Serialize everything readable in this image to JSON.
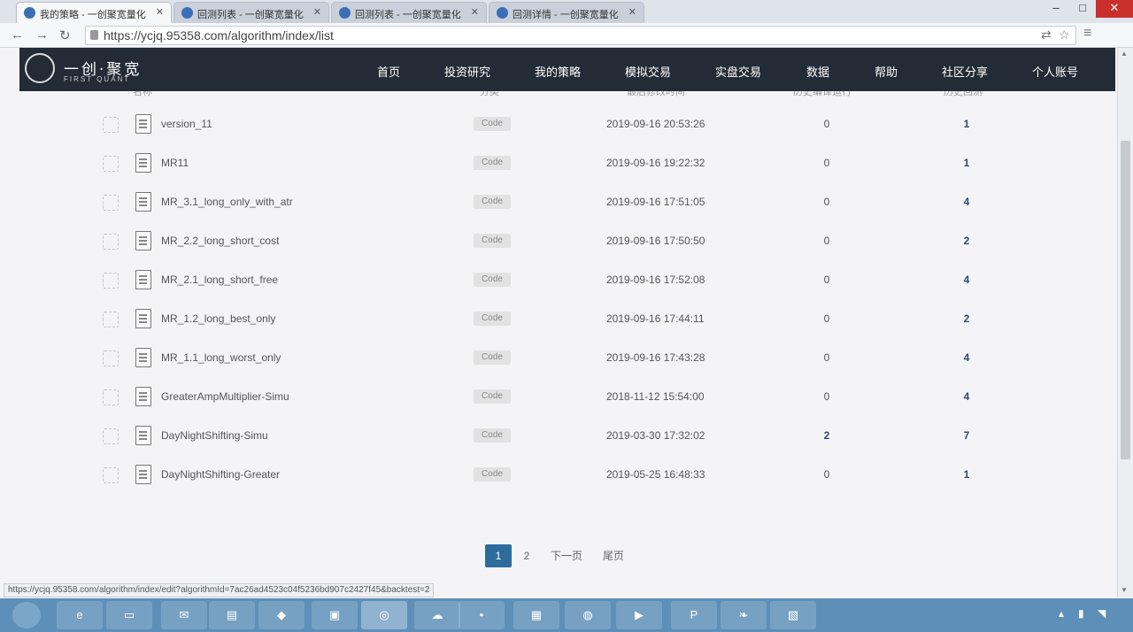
{
  "browser": {
    "tabs": [
      {
        "title": "我的策略 - 一创聚宽量化"
      },
      {
        "title": "回测列表 - 一创聚宽量化"
      },
      {
        "title": "回测列表 - 一创聚宽量化"
      },
      {
        "title": "回测详情 - 一创聚宽量化"
      }
    ],
    "url": "https://ycjq.95358.com/algorithm/index/list",
    "status_url": "https://ycjq.95358.com/algorithm/index/edit?algorithmId=7ac26ad4523c04f5236bd907c2427f45&backtest=2"
  },
  "site": {
    "logo_text": "一创·聚宽",
    "logo_sub": "FIRST QUANT",
    "nav": [
      "首页",
      "投资研究",
      "我的策略",
      "模拟交易",
      "实盘交易",
      "数据",
      "帮助",
      "社区分享",
      "个人账号"
    ]
  },
  "table": {
    "headers": [
      "名称",
      "分类",
      "最后修改时间",
      "历史编译运行",
      "历史回测"
    ],
    "rows": [
      {
        "name": "version_11",
        "tag": "Code",
        "time": "2019-09-16 20:53:26",
        "runs": "0",
        "backtests": "1"
      },
      {
        "name": "MR11",
        "tag": "Code",
        "time": "2019-09-16 19:22:32",
        "runs": "0",
        "backtests": "1"
      },
      {
        "name": "MR_3.1_long_only_with_atr",
        "tag": "Code",
        "time": "2019-09-16 17:51:05",
        "runs": "0",
        "backtests": "4"
      },
      {
        "name": "MR_2.2_long_short_cost",
        "tag": "Code",
        "time": "2019-09-16 17:50:50",
        "runs": "0",
        "backtests": "2"
      },
      {
        "name": "MR_2.1_long_short_free",
        "tag": "Code",
        "time": "2019-09-16 17:52:08",
        "runs": "0",
        "backtests": "4"
      },
      {
        "name": "MR_1.2_long_best_only",
        "tag": "Code",
        "time": "2019-09-16 17:44:11",
        "runs": "0",
        "backtests": "2"
      },
      {
        "name": "MR_1.1_long_worst_only",
        "tag": "Code",
        "time": "2019-09-16 17:43:28",
        "runs": "0",
        "backtests": "4"
      },
      {
        "name": "GreaterAmpMultiplier-Simu",
        "tag": "Code",
        "time": "2018-11-12 15:54:00",
        "runs": "0",
        "backtests": "4"
      },
      {
        "name": "DayNightShifting-Simu",
        "tag": "Code",
        "time": "2019-03-30 17:32:02",
        "runs": "2",
        "backtests": "7"
      },
      {
        "name": "DayNightShifting-Greater",
        "tag": "Code",
        "time": "2019-05-25 16:48:33",
        "runs": "0",
        "backtests": "1"
      }
    ]
  },
  "pagination": {
    "current": "1",
    "page2": "2",
    "next": "下一页",
    "last": "尾页"
  }
}
